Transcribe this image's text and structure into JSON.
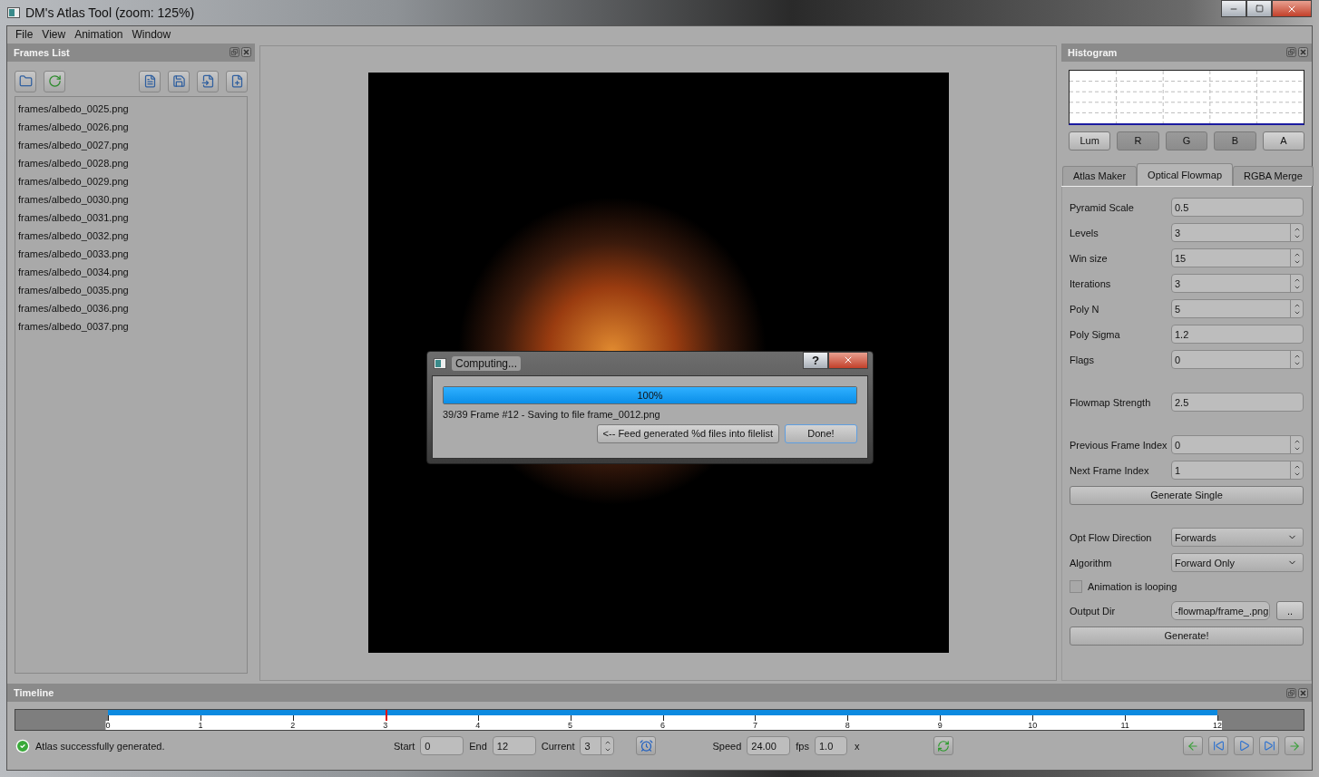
{
  "window": {
    "title": "DM's Atlas Tool (zoom: 125%)"
  },
  "menu": [
    "File",
    "View",
    "Animation",
    "Window"
  ],
  "frames_list": {
    "title": "Frames List",
    "files": [
      "frames/albedo_0025.png",
      "frames/albedo_0026.png",
      "frames/albedo_0027.png",
      "frames/albedo_0028.png",
      "frames/albedo_0029.png",
      "frames/albedo_0030.png",
      "frames/albedo_0031.png",
      "frames/albedo_0032.png",
      "frames/albedo_0033.png",
      "frames/albedo_0034.png",
      "frames/albedo_0035.png",
      "frames/albedo_0036.png",
      "frames/albedo_0037.png"
    ]
  },
  "dialog": {
    "title": "Computing...",
    "help_label": "?",
    "progress": {
      "level": 1.0,
      "text": "100%"
    },
    "message": "39/39 Frame #12 - Saving to file frame_0012.png",
    "buttons": [
      {
        "label": "<-- Feed generated %d files into filelist",
        "default": false
      },
      {
        "label": "Done!",
        "default": true
      }
    ]
  },
  "histogram": {
    "title": "Histogram",
    "channels": [
      {
        "label": "Lum",
        "selected": false
      },
      {
        "label": "R",
        "selected": true
      },
      {
        "label": "G",
        "selected": true
      },
      {
        "label": "B",
        "selected": true
      },
      {
        "label": "A",
        "selected": false
      }
    ]
  },
  "tabs": [
    {
      "label": "Atlas Maker",
      "selected": false
    },
    {
      "label": "Optical Flowmap",
      "selected": true
    },
    {
      "label": "RGBA Merge",
      "selected": false
    }
  ],
  "form": [
    {
      "kind": "text",
      "label": "Pyramid Scale",
      "value": "0.5"
    },
    {
      "kind": "spin",
      "label": "Levels",
      "value": "3"
    },
    {
      "kind": "spin",
      "label": "Win size",
      "value": "15"
    },
    {
      "kind": "spin",
      "label": "Iterations",
      "value": "3"
    },
    {
      "kind": "spin",
      "label": "Poly N",
      "value": "5"
    },
    {
      "kind": "text",
      "label": "Poly Sigma",
      "value": "1.2"
    },
    {
      "kind": "spin",
      "label": "Flags",
      "value": "0"
    },
    {
      "kind": "gap"
    },
    {
      "kind": "text",
      "label": "Flowmap Strength",
      "value": "2.5"
    },
    {
      "kind": "gap"
    },
    {
      "kind": "spin",
      "label": "Previous Frame Index",
      "value": "0"
    },
    {
      "kind": "spin",
      "label": "Next Frame Index",
      "value": "1"
    },
    {
      "kind": "button",
      "label": "Generate Single"
    },
    {
      "kind": "gap"
    },
    {
      "kind": "combo",
      "label": "Opt Flow Direction",
      "value": "Forwards"
    },
    {
      "kind": "combo",
      "label": "Algorithm",
      "value": "Forward Only"
    },
    {
      "kind": "checkbox",
      "label": "Animation is looping",
      "checked": false
    },
    {
      "kind": "file",
      "label": "Output Dir",
      "value": "-flowmap/frame_.png",
      "button": ".."
    },
    {
      "kind": "button",
      "label": "Generate!"
    }
  ],
  "timeline": {
    "title": "Timeline",
    "ticks": [
      "0",
      "1",
      "2",
      "3",
      "4",
      "5",
      "6",
      "7",
      "8",
      "9",
      "10",
      "11",
      "12"
    ],
    "level": 0.25,
    "status": "Atlas successfully generated.",
    "start_label": "Start",
    "start": "0",
    "end_label": "End",
    "end": "12",
    "current_label": "Current",
    "current": "3",
    "speed_label": "Speed",
    "speed": "24.00",
    "fps_label": "fps",
    "multiplier": "1.0",
    "x_label": "x"
  }
}
